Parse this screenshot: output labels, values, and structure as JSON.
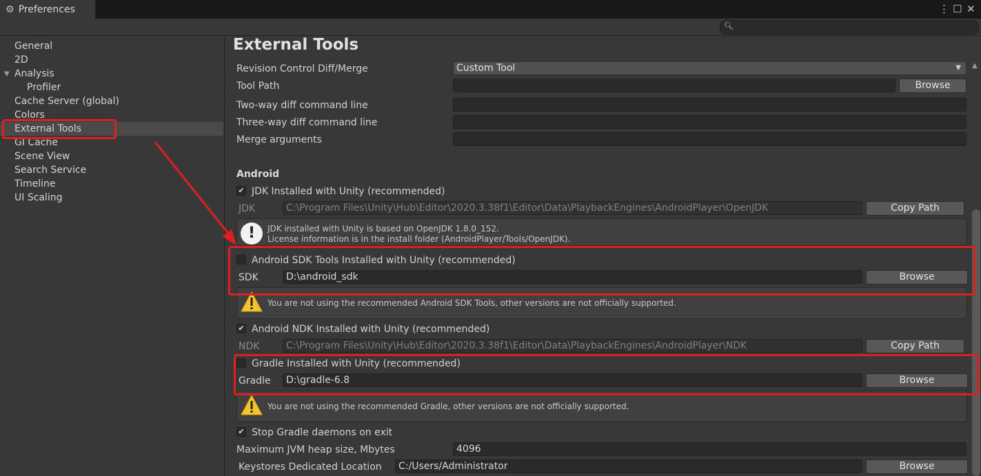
{
  "window": {
    "title": "Preferences"
  },
  "sidebar": {
    "items": [
      {
        "label": "General"
      },
      {
        "label": "2D"
      },
      {
        "label": "Analysis"
      },
      {
        "label": "Profiler"
      },
      {
        "label": "Cache Server (global)"
      },
      {
        "label": "Colors"
      },
      {
        "label": "External Tools"
      },
      {
        "label": "GI Cache"
      },
      {
        "label": "Scene View"
      },
      {
        "label": "Search Service"
      },
      {
        "label": "Timeline"
      },
      {
        "label": "UI Scaling"
      }
    ],
    "selected": "External Tools"
  },
  "page": {
    "title": "External Tools"
  },
  "revision": {
    "diff_label": "Revision Control Diff/Merge",
    "diff_value": "Custom Tool",
    "tool_path_label": "Tool Path",
    "tool_path_value": "",
    "browse": "Browse",
    "two_way_label": "Two-way diff command line",
    "three_way_label": "Three-way diff command line",
    "merge_label": "Merge arguments"
  },
  "android": {
    "section": "Android",
    "jdk_check_label": "JDK Installed with Unity (recommended)",
    "jdk_checked": true,
    "jdk_label": "JDK",
    "jdk_path": "C:\\Program Files\\Unity\\Hub\\Editor\\2020.3.38f1\\Editor\\Data\\PlaybackEngines\\AndroidPlayer\\OpenJDK",
    "copy_path": "Copy Path",
    "jdk_info_1": "JDK installed with Unity is based on OpenJDK 1.8.0_152.",
    "jdk_info_2": "License information is in the install folder (AndroidPlayer/Tools/OpenJDK).",
    "sdk_check_label": "Android SDK Tools Installed with Unity (recommended)",
    "sdk_checked": false,
    "sdk_label": "SDK",
    "sdk_path": "D:\\android_sdk",
    "browse": "Browse",
    "sdk_warning": "You are not using the recommended Android SDK Tools, other versions are not officially supported.",
    "ndk_check_label": "Android NDK Installed with Unity (recommended)",
    "ndk_checked": true,
    "ndk_label": "NDK",
    "ndk_path": "C:\\Program Files\\Unity\\Hub\\Editor\\2020.3.38f1\\Editor\\Data\\PlaybackEngines\\AndroidPlayer\\NDK",
    "gradle_check_label": "Gradle Installed with Unity (recommended)",
    "gradle_checked": false,
    "gradle_label": "Gradle",
    "gradle_path": "D:\\gradle-6.8",
    "gradle_warning": "You are not using the recommended Gradle, other versions are not officially supported.",
    "stop_daemons_label": "Stop Gradle daemons on exit",
    "stop_daemons_checked": true,
    "jvm_label": "Maximum JVM heap size, Mbytes",
    "jvm_value": "4096",
    "keystore_label": "Keystores Dedicated Location",
    "keystore_value": "C:/Users/Administrator"
  },
  "colors": {
    "annotation_red": "#e02020",
    "selection_bg": "#4a4a4a"
  }
}
